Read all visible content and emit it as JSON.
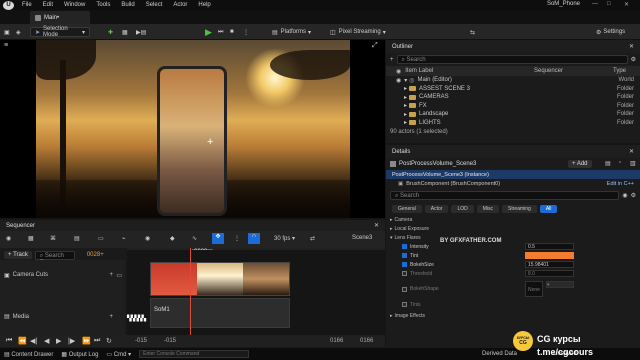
{
  "menubar": {
    "items": [
      "File",
      "Edit",
      "Window",
      "Tools",
      "Build",
      "Select",
      "Actor",
      "Help"
    ],
    "project": "SoM_Phone"
  },
  "tab": {
    "label": "Main•"
  },
  "toolbar": {
    "selection_mode": "Selection Mode",
    "platforms": "Platforms",
    "pixel_streaming": "Pixel Streaming",
    "settings": "Settings"
  },
  "outliner": {
    "tab_label": "Outliner",
    "search_placeholder": "Search",
    "col_item": "Item Label",
    "col_seq": "Sequencer",
    "col_type": "Type",
    "rows": [
      {
        "label": "Main (Editor)",
        "type": "World"
      },
      {
        "label": "ASSEST SCENE 3",
        "type": "Folder"
      },
      {
        "label": "CAMERAS",
        "type": "Folder"
      },
      {
        "label": "FX",
        "type": "Folder"
      },
      {
        "label": "Landscape",
        "type": "Folder"
      },
      {
        "label": "LIGHTS",
        "type": "Folder"
      }
    ],
    "status": "90 actors (1 selected)"
  },
  "details": {
    "tab_label": "Details",
    "object": "PostProcessVolume_Scene3",
    "add": "+ Add",
    "instance": "PostProcessVolume_Scene3 (Instance)",
    "component": "BrushComponent (BrushComponent0)",
    "edit_cpp": "Edit in C++",
    "search_placeholder": "Search",
    "filters": [
      "General",
      "Actor",
      "LOD",
      "Misc",
      "Streaming",
      "All"
    ],
    "sections": [
      "Camera",
      "Local Exposure",
      "Lens Flares"
    ],
    "props": [
      {
        "label": "Intensity",
        "value": "0.5",
        "checked": true
      },
      {
        "label": "Tint",
        "value": "",
        "checked": true
      },
      {
        "label": "BokehSize",
        "value": "15.98401",
        "checked": true
      },
      {
        "label": "Threshold",
        "value": "8.0",
        "checked": false
      },
      {
        "label": "BokehShape",
        "value": "None",
        "checked": false
      },
      {
        "label": "Tints",
        "value": "",
        "checked": false
      }
    ],
    "bottom_section": "Image Effects",
    "tint_color": "#f47c30"
  },
  "sequencer": {
    "tab_label": "Sequencer",
    "track_button": "+ Track",
    "search_placeholder": "Search Trac",
    "frame": "0028+",
    "fps": "30 fps",
    "scene": "Scene3",
    "tracks": [
      "Camera Cuts",
      "Media"
    ],
    "clip_label": "SoM1",
    "timecode_left": "-015",
    "timecode_left2": "-015",
    "timecode_right": "0166",
    "timecode_right2": "0166"
  },
  "statusbar": {
    "content_drawer": "Content Drawer",
    "output_log": "Output Log",
    "cmd": "Cmd",
    "console_placeholder": "Enter Console Command",
    "derived_data": "Derived Data",
    "unsaved": "Unsaved"
  },
  "watermark": {
    "top": "BY GFXFATHER.COM",
    "logo1": "КУРСЫ",
    "logo2": "CG",
    "line1": "CG курсы",
    "line2": "t.me/cgcours"
  }
}
